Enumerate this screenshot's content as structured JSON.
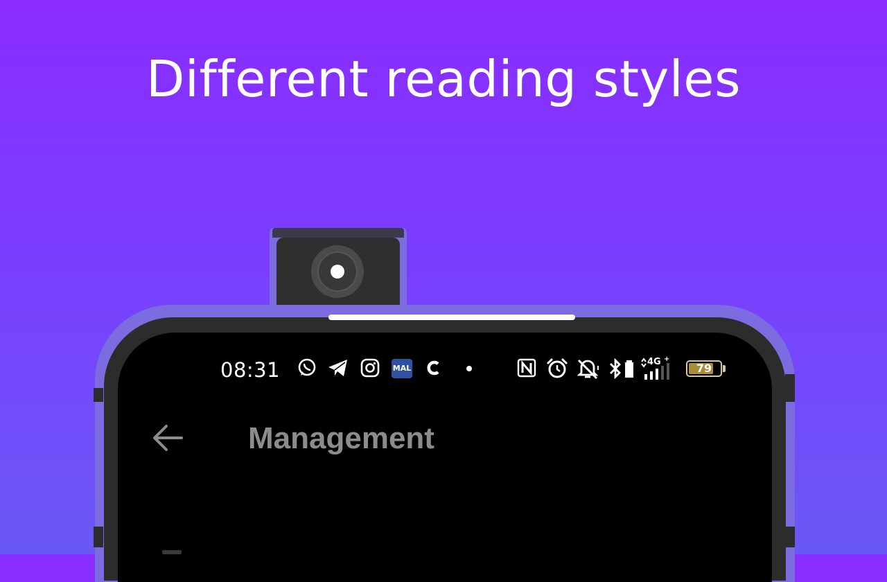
{
  "headline": "Different reading styles",
  "colors": {
    "background_top": "#8a2cff",
    "background_bottom": "#6a58f6",
    "phone_frame": "#7b6ce0",
    "battery_fill": "#a88c3c"
  },
  "status_bar": {
    "time": "08:31",
    "notification_icons": [
      "whatsapp-icon",
      "telegram-icon",
      "instagram-icon",
      "mal-icon",
      "c-app-icon",
      "dot-icon"
    ],
    "mal_badge_text": "MAL",
    "system_icons": [
      "nfc-icon",
      "alarm-icon",
      "bell-off-icon",
      "bluetooth-icon",
      "battery-small-icon",
      "signal-4g-icon"
    ],
    "network_label": "4G",
    "battery_percent": 79,
    "battery_label": "79"
  },
  "app_bar": {
    "back_icon": "back-arrow-icon",
    "title": "Management"
  }
}
